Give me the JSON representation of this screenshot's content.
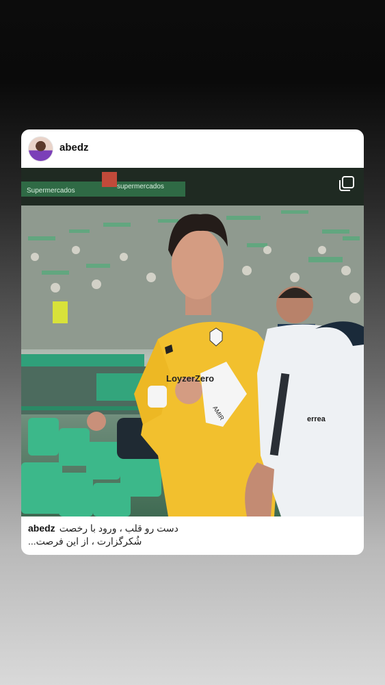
{
  "post": {
    "username": "abedz",
    "avatar_icon": "profile-avatar",
    "multi_image_icon": "carousel-icon",
    "caption_user": "abedz",
    "caption_line1": "دست رو قلب ، ورود با رخصت",
    "caption_line2": "شُکرگزارت ، از این فرصت..."
  },
  "photo": {
    "shirt_sponsor": "LoyzerZero",
    "glove_text": "AMIR",
    "kit_brand": "errea",
    "stadium_banner_1": "Supermercados",
    "stadium_banner_2": "supermercados"
  },
  "colors": {
    "card_bg": "#ffffff",
    "jersey_yellow": "#f2c02e",
    "seat_green": "#3cb88a",
    "fans_green": "#5ea87e"
  }
}
